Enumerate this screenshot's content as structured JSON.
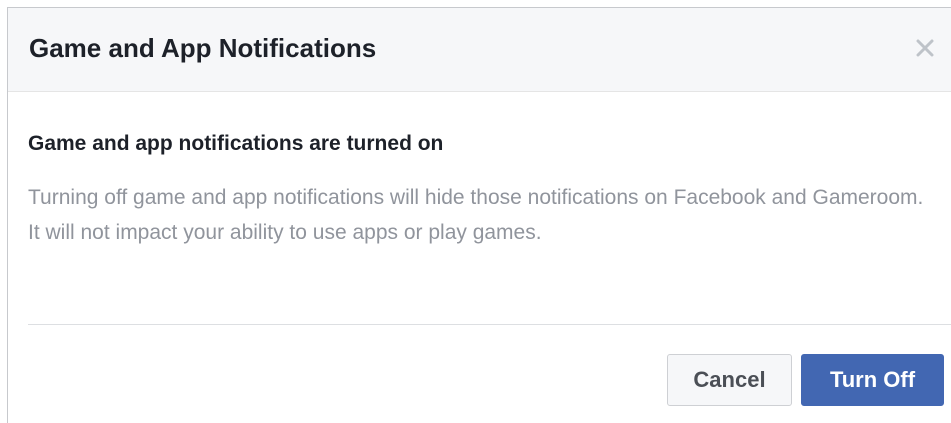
{
  "dialog": {
    "title": "Game and App Notifications",
    "close_icon": "close-icon",
    "subheading": "Game and app notifications are turned on",
    "description": "Turning off game and app notifications will hide those notifications on Facebook and Gameroom. It will not impact your ability to use apps or play games.",
    "buttons": {
      "cancel_label": "Cancel",
      "confirm_label": "Turn Off"
    }
  },
  "colors": {
    "primary": "#4267b2",
    "header_bg": "#f6f7f9",
    "title_text": "#1d2129",
    "muted_text": "#90949c"
  }
}
